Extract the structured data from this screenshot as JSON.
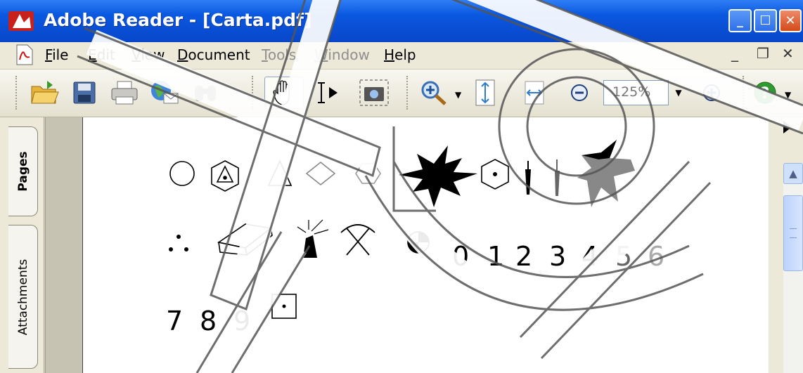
{
  "window": {
    "title": "Adobe Reader - [Carta.pdf]"
  },
  "menu": {
    "file": "File",
    "edit": "Edit",
    "view": "View",
    "document": "Document",
    "tools": "Tools",
    "window": "Window",
    "help": "Help"
  },
  "menu_underline": {
    "file": "F",
    "edit": "E",
    "view": "V",
    "document": "D",
    "tools": "T",
    "window": "W",
    "help": "H"
  },
  "mdi": {
    "minimize": "_",
    "restore": "❐",
    "close": "✕"
  },
  "toolbar": {
    "zoom_value": "125%",
    "icons": [
      "open-icon",
      "save-icon",
      "print-icon",
      "email-icon",
      "search-icon",
      "hand-icon",
      "select-text-icon",
      "snapshot-icon",
      "zoom-in-icon",
      "fit-page-icon",
      "fit-width-icon",
      "zoom-out-icon",
      "zoom-plus-icon",
      "help-icon"
    ]
  },
  "left_tabs": {
    "pages": "Pages",
    "attachments": "Attachments"
  },
  "page_content": {
    "digits_row2": [
      "0",
      "1",
      "2",
      "3",
      "4",
      "5",
      "6"
    ],
    "digits_row3": [
      "7",
      "8",
      "9"
    ]
  },
  "colors": {
    "titlebar": "#0a58e0",
    "chrome": "#ece9d8",
    "page": "#ffffff",
    "scroll_accent": "#cfe0fb"
  }
}
